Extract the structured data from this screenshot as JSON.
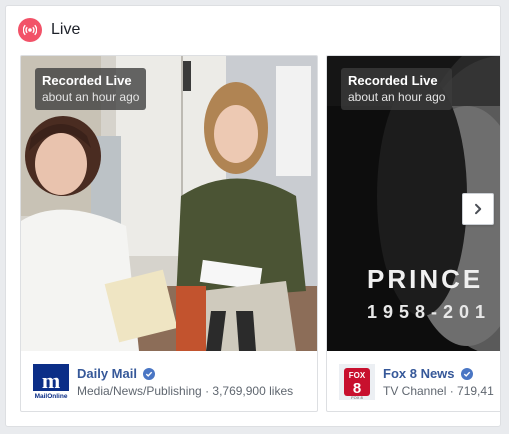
{
  "section": {
    "title": "Live",
    "icon": "live-broadcast-icon",
    "accent_color": "#f25268"
  },
  "videos": [
    {
      "overlay_title": "Recorded Live",
      "overlay_subtitle": "about an hour ago",
      "page_name": "Daily Mail",
      "verified": true,
      "page_description": "Media/News/Publishing · 3,769,900 likes",
      "logo": "daily-mail-logo",
      "logo_text": "MailOnline"
    },
    {
      "overlay_title": "Recorded Live",
      "overlay_subtitle": "about an hour ago",
      "page_name": "Fox 8 News",
      "verified": true,
      "page_description": "TV Channel · 719,41",
      "logo": "fox8-logo",
      "logo_text": "FOX 8",
      "video_caption_line1": "PRINCE",
      "video_caption_line2": "1958-201"
    }
  ],
  "controls": {
    "next_icon": "chevron-right-icon"
  },
  "colors": {
    "link": "#365899",
    "verified": "#4a76c4",
    "secondary_text": "#606770"
  }
}
